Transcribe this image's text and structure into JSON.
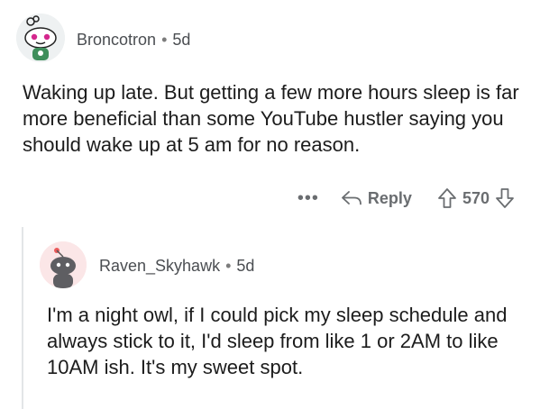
{
  "comments": [
    {
      "username": "Broncotron",
      "separator": "•",
      "age": "5d",
      "body": "Waking up late.  But getting a few more hours sleep is far more beneficial than some YouTube hustler saying you should wake up at 5 am for no reason.",
      "actions": {
        "more": "•••",
        "reply": "Reply",
        "score": "570"
      }
    },
    {
      "username": "Raven_Skyhawk",
      "separator": "•",
      "age": "5d",
      "body": "I'm a night owl, if I could pick my sleep schedule and always stick to it, I'd sleep from like 1 or 2AM to like 10AM ish. It's my sweet spot."
    }
  ],
  "icons": {
    "reply": "reply-arrow-icon",
    "upvote": "upvote-arrow-icon",
    "downvote": "downvote-arrow-icon"
  },
  "colors": {
    "text": "#1c1c1c",
    "meta": "#4b4e52",
    "action": "#6a6d70",
    "thread_line": "#e3e5e7"
  }
}
